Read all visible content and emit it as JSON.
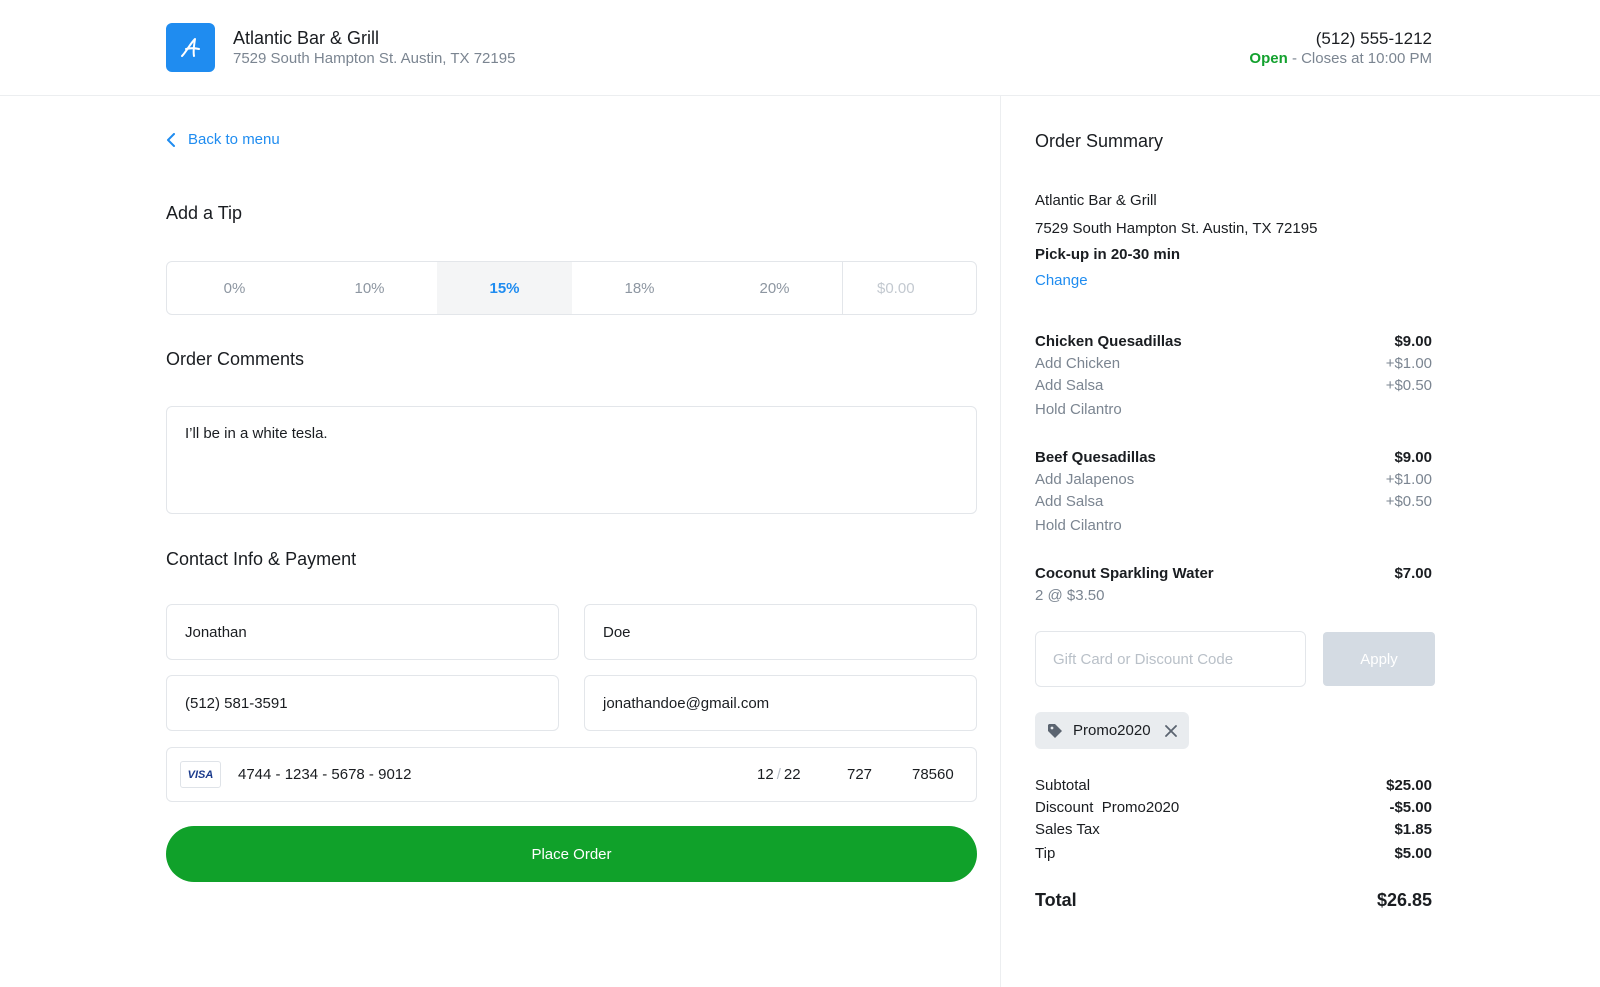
{
  "header": {
    "name": "Atlantic Bar & Grill",
    "address": "7529 South Hampton St. Austin, TX 72195",
    "phone": "(512) 555-1212",
    "status": "Open",
    "closes": "- Closes at 10:00 PM",
    "logo_icon": "script-a-logo-icon",
    "accent_color": "#1f8cf0",
    "open_color": "#13a12e"
  },
  "back_link": "Back to menu",
  "tip": {
    "title": "Add a Tip",
    "options": [
      "0%",
      "10%",
      "15%",
      "18%",
      "20%"
    ],
    "selected": "15%",
    "custom_placeholder": "$0.00"
  },
  "comments": {
    "title": "Order Comments",
    "value": "I’ll be in a white tesla."
  },
  "contact": {
    "title": "Contact Info & Payment",
    "first_name": "Jonathan",
    "last_name": "Doe",
    "phone": "(512) 581-3591",
    "email": "jonathandoe@gmail.com",
    "card_brand": "VISA",
    "card_number": "4744 - 1234 - 5678 - 9012",
    "exp_month": "12",
    "exp_sep": "/",
    "exp_year": "22",
    "cvc": "727",
    "zip": "78560"
  },
  "place_order_label": "Place Order",
  "place_order_color": "#10a12a",
  "summary": {
    "title": "Order Summary",
    "restaurant": "Atlantic Bar & Grill",
    "address": "7529 South Hampton St. Austin, TX 72195",
    "pickup": "Pick-up in 20-30 min",
    "change": "Change",
    "items": [
      {
        "name": "Chicken Quesadillas",
        "price": "$9.00",
        "mods": [
          {
            "label": "Add Chicken",
            "price": "+$1.00"
          },
          {
            "label": "Add Salsa",
            "price": "+$0.50"
          },
          {
            "label": "Hold Cilantro",
            "price": ""
          }
        ]
      },
      {
        "name": "Beef Quesadillas",
        "price": "$9.00",
        "mods": [
          {
            "label": "Add Jalapenos",
            "price": "+$1.00"
          },
          {
            "label": "Add Salsa",
            "price": "+$0.50"
          },
          {
            "label": "Hold Cilantro",
            "price": ""
          }
        ]
      },
      {
        "name": "Coconut Sparkling Water",
        "price": "$7.00",
        "mods": [
          {
            "label": "2 @ $3.50",
            "price": ""
          }
        ]
      }
    ],
    "code_placeholder": "Gift Card or Discount Code",
    "apply_label": "Apply",
    "promo_code": "Promo2020",
    "totals": {
      "subtotal_label": "Subtotal",
      "subtotal": "$25.00",
      "discount_label": "Discount  Promo2020",
      "discount": "-$5.00",
      "tax_label": "Sales Tax",
      "tax": "$1.85",
      "tip_label": "Tip",
      "tip": "$5.00",
      "total_label": "Total",
      "total": "$26.85"
    }
  }
}
